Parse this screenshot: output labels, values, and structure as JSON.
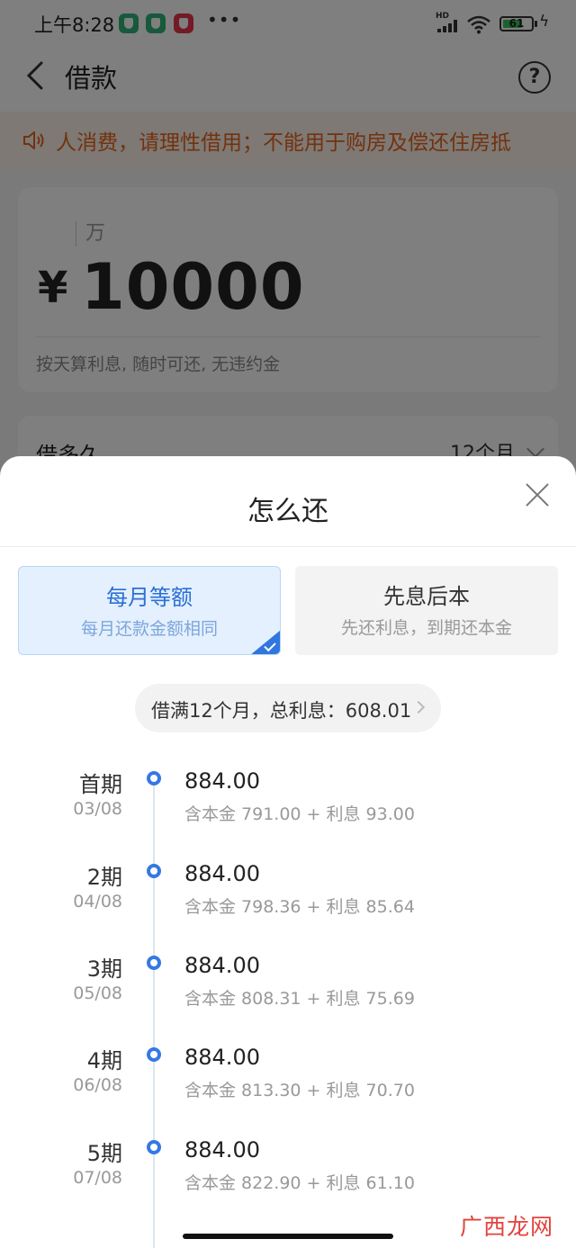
{
  "status_bar": {
    "time": "上午8:28",
    "more": "•••",
    "network": "HD",
    "battery": "61"
  },
  "header": {
    "title": "借款",
    "help": "?"
  },
  "notice": {
    "text": "人消费，请理性借用；不能用于购房及偿还住房抵"
  },
  "amount_card": {
    "unit": "万",
    "currency": "¥",
    "amount": "10000",
    "hint": "按天算利息, 随时可还, 无违约金"
  },
  "term_row": {
    "label": "借多久",
    "value": "12个月"
  },
  "sheet": {
    "title": "怎么还",
    "options": [
      {
        "title": "每月等额",
        "subtitle": "每月还款金额相同"
      },
      {
        "title": "先息后本",
        "subtitle": "先还利息，到期还本金"
      }
    ],
    "summary": "借满12个月，总利息：608.01",
    "schedule": [
      {
        "period": "首期",
        "date": "03/08",
        "amount": "884.00",
        "detail": "含本金 791.00 + 利息 93.00"
      },
      {
        "period": "2期",
        "date": "04/08",
        "amount": "884.00",
        "detail": "含本金 798.36 + 利息 85.64"
      },
      {
        "period": "3期",
        "date": "05/08",
        "amount": "884.00",
        "detail": "含本金 808.31 + 利息 75.69"
      },
      {
        "period": "4期",
        "date": "06/08",
        "amount": "884.00",
        "detail": "含本金 813.30 + 利息 70.70"
      },
      {
        "period": "5期",
        "date": "07/08",
        "amount": "884.00",
        "detail": "含本金 822.90 + 利息 61.10"
      }
    ]
  },
  "watermark": "广西龙网",
  "colors": {
    "accent": "#3578e5",
    "notice_text": "#e4651f",
    "selected_bg": "#e4f0fd"
  }
}
